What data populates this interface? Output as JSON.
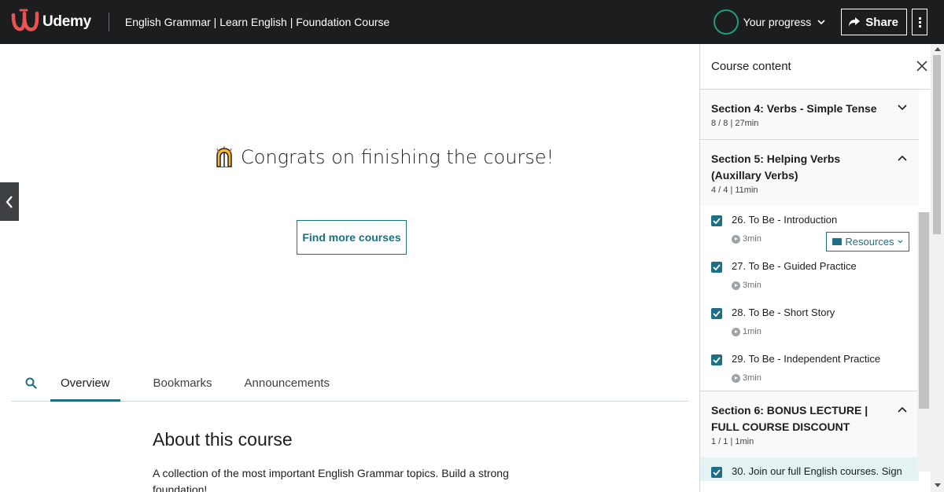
{
  "header": {
    "logo_text": "Udemy",
    "course_title": "English Grammar | Learn English | Foundation Course",
    "progress_label": "Your progress",
    "share_label": "Share"
  },
  "main": {
    "congrats_text": "Congrats on finishing the course!",
    "find_more_label": "Find more courses",
    "tabs": [
      {
        "label": "Overview",
        "active": true
      },
      {
        "label": "Bookmarks",
        "active": false
      },
      {
        "label": "Announcements",
        "active": false
      }
    ],
    "about_heading": "About this course",
    "about_text": "A collection of the most important English Grammar topics. Build a strong foundation!"
  },
  "sidebar": {
    "title": "Course content",
    "sections": [
      {
        "title": "Section 4: Verbs - Simple Tense",
        "meta": "8 / 8 | 27min",
        "expanded": false
      },
      {
        "title": "Section 5: Helping Verbs (Auxillary Verbs)",
        "meta": "4 / 4 | 11min",
        "expanded": true
      },
      {
        "title": "Section 6: BONUS LECTURE | FULL COURSE DISCOUNT",
        "meta": "1 / 1 | 1min",
        "expanded": true
      }
    ],
    "lectures": [
      {
        "title": "26. To Be - Introduction",
        "duration": "3min",
        "completed": true
      },
      {
        "title": "27. To Be - Guided Practice",
        "duration": "3min",
        "completed": true
      },
      {
        "title": "28. To Be - Short Story",
        "duration": "1min",
        "completed": true
      },
      {
        "title": "29. To Be - Independent Practice",
        "duration": "3min",
        "completed": true
      },
      {
        "title": "30. Join our full English courses. Sign",
        "completed": true
      }
    ],
    "resources_label": "Resources"
  },
  "colors": {
    "header_bg": "#1c1d1f",
    "accent": "#1c6f84",
    "progress_ring": "#1e9d79",
    "logo_red": "#ec5252"
  }
}
